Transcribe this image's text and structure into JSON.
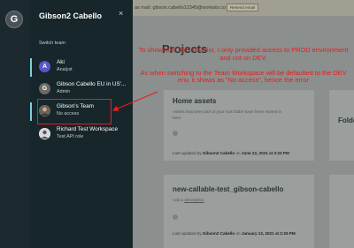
{
  "rail": {
    "avatar_initial": "G"
  },
  "switcher": {
    "title": "Gibson2 Cabello",
    "close_glyph": "×",
    "section_label": "Switch team",
    "teams": [
      {
        "name": "Aki",
        "role": "Analyst",
        "initial": "A",
        "avatar_color": "#5b57c8",
        "active": true
      },
      {
        "name": "Gibson Cabello EU in US'...",
        "role": "Admin",
        "initial": "G",
        "avatar_color": "#6e6a66",
        "active": false
      },
      {
        "name": "Gibson's Team",
        "role": "No access",
        "initial": "",
        "avatar_color": "#6b6254",
        "active": true
      },
      {
        "name": "Richard Test Workspace",
        "role": "Test API role",
        "initial": "",
        "avatar_color": "#d9dadb",
        "active": false
      }
    ]
  },
  "topbar": {
    "text": "as mail: gibson.cabello12345@workato.co",
    "button_label": "Resend email"
  },
  "main": {
    "heading": "Projects",
    "cards": [
      {
        "title": "Home assets",
        "desc": "Assets that were part of your root folder have been moved in here",
        "meta_prefix": "Last updated by ",
        "meta_user": "Gibson2 Cabello",
        "meta_mid": " on ",
        "meta_date": "June 22, 2021 at 3:23 PM"
      },
      {
        "title": "new-callable-test_gibson-cabello",
        "link_prefix": "Add a ",
        "link_text": "description",
        "meta_prefix": "Last updated by ",
        "meta_user": "Gibson2 Cabello",
        "meta_mid": " on ",
        "meta_date": "January 12, 2021 at 2:29 PM"
      }
    ],
    "partial_card_title": "Folde"
  },
  "annotation": {
    "line1": "To showcase the behavior, I only provided access to PROD environment and not on DEV.",
    "line2": "As when switching to the Team Workspace will be defaulted to the DEV env, it shows as \"No access\", hence the error",
    "color": "#e61e1e"
  }
}
